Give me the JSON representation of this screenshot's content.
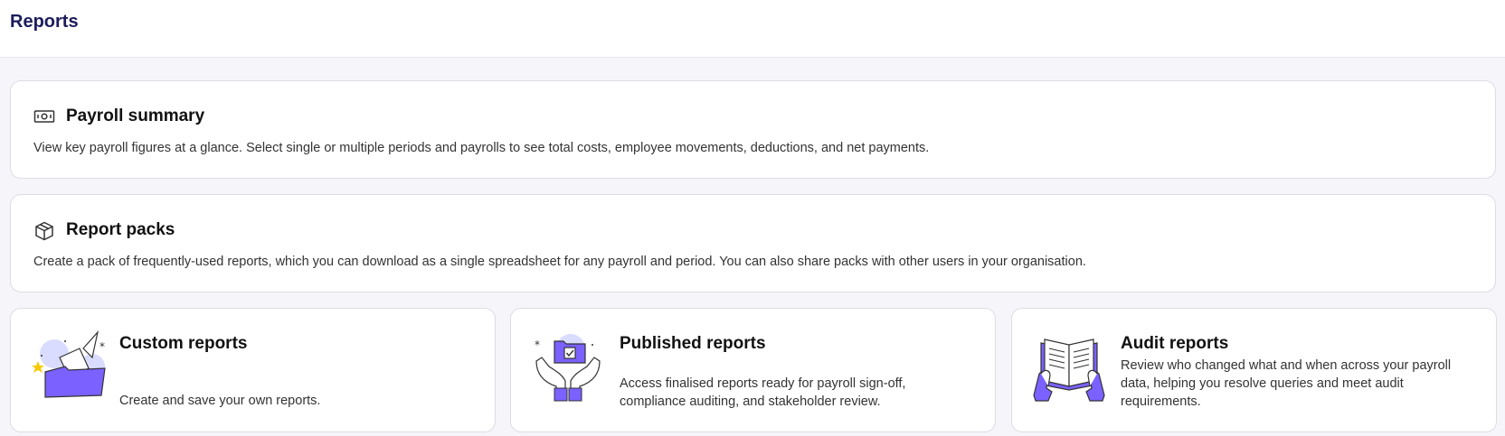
{
  "page": {
    "title": "Reports"
  },
  "cards": {
    "payroll_summary": {
      "title": "Payroll summary",
      "description": "View key payroll figures at a glance. Select single or multiple periods and payrolls to see total costs, employee movements, deductions, and net payments.",
      "icon": "banknote-icon"
    },
    "report_packs": {
      "title": "Report packs",
      "description": "Create a pack of frequently-used reports, which you can download as a single spreadsheet for any payroll and period. You can also share packs with other users in your organisation.",
      "icon": "package-icon"
    },
    "custom_reports": {
      "title": "Custom reports",
      "description": "Create and save your own reports.",
      "icon": "folder-documents-illustration"
    },
    "published_reports": {
      "title": "Published reports",
      "description": "Access finalised reports ready for payroll sign-off, compliance auditing, and stakeholder review.",
      "icon": "hands-folder-illustration"
    },
    "audit_reports": {
      "title": "Audit reports",
      "description": "Review who changed what and when across your payroll data, helping you resolve queries and meet audit requirements.",
      "icon": "hands-book-illustration"
    }
  },
  "colors": {
    "accent": "#7b61ff",
    "accent_light": "#d9dcff",
    "title": "#1c1c5c",
    "star": "#f7c900"
  }
}
